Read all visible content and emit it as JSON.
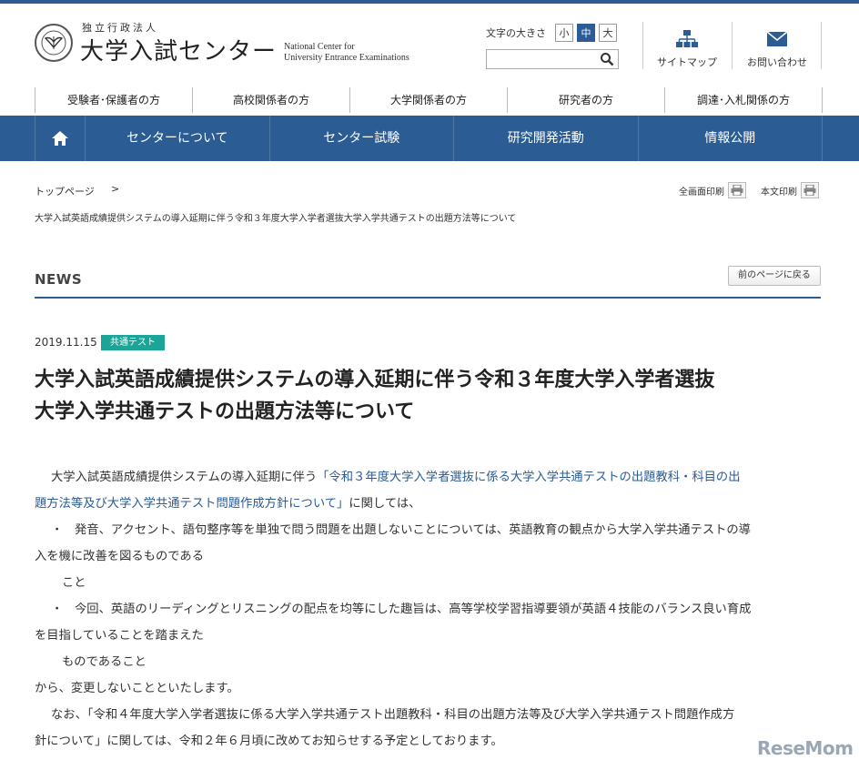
{
  "header": {
    "org_small": "独立行政法人",
    "org_name": "大学入試センター",
    "org_en_line1": "National Center for",
    "org_en_line2": "University Entrance Examinations",
    "fontsize_label": "文字の大きさ",
    "fontsize_options": [
      "小",
      "中",
      "大"
    ],
    "search_placeholder": "",
    "sitemap_label": "サイトマップ",
    "contact_label": "お問い合わせ"
  },
  "audience_nav": [
    "受験者･保護者の方",
    "高校関係者の方",
    "大学関係者の方",
    "研究者の方",
    "調達･入札関係の方"
  ],
  "main_nav": [
    "センターについて",
    "センター試験",
    "研究開発活動",
    "情報公開"
  ],
  "breadcrumb": {
    "home": "トップページ",
    "separator": ">",
    "current": "大学入試英語成績提供システムの導入延期に伴う令和３年度大学入学者選抜大学入学共通テストの出題方法等について"
  },
  "print": {
    "full": "全画面印刷",
    "body": "本文印刷"
  },
  "news": {
    "heading": "NEWS",
    "back_label": "前のページに戻る"
  },
  "article": {
    "date": "2019.11.15",
    "tag": "共通テスト",
    "title_line1": "大学入試英語成績提供システムの導入延期に伴う令和３年度大学入学者選抜",
    "title_line2": "大学入学共通テストの出題方法等について",
    "p1_lead": "大学入試英語成績提供システムの導入延期に伴う",
    "p1_link_a": "「令和３年度大学入学者選抜に係る大学入学共通テストの出題教科・科目の出",
    "p1_link_b": "題方法等及び大学入学共通テスト問題作成方針について」",
    "p1_tail": "に関しては、",
    "bullet_mark": "・",
    "b1_line1": "発音、アクセント、語句整序等を単独で問う問題を出題しないことについては、英語教育の観点から大学入学共通テストの導",
    "b1_line2": "入を機に改善を図るものである",
    "b1_line3": "こと",
    "b2_line1": "今回、英語のリーディングとリスニングの配点を均等にした趣旨は、高等学校学習指導要領が英語４技能のバランス良い育成",
    "b2_line2": "を目指していることを踏まえた",
    "b2_line3": "ものであること",
    "closing": "から、変更しないことといたします。",
    "p2_line1": "なお、「令和４年度大学入学者選抜に係る大学入学共通テスト出題教科・科目の出題方法等及び大学入学共通テスト問題作成方",
    "p2_line2": "針について」に関しては、令和２年６月頃に改めてお知らせする予定としております。"
  },
  "watermark": "ReseMom",
  "colors": {
    "brand_blue": "#2b5c93",
    "tag_teal": "#1aa598",
    "link_blue": "#2b5c93"
  }
}
